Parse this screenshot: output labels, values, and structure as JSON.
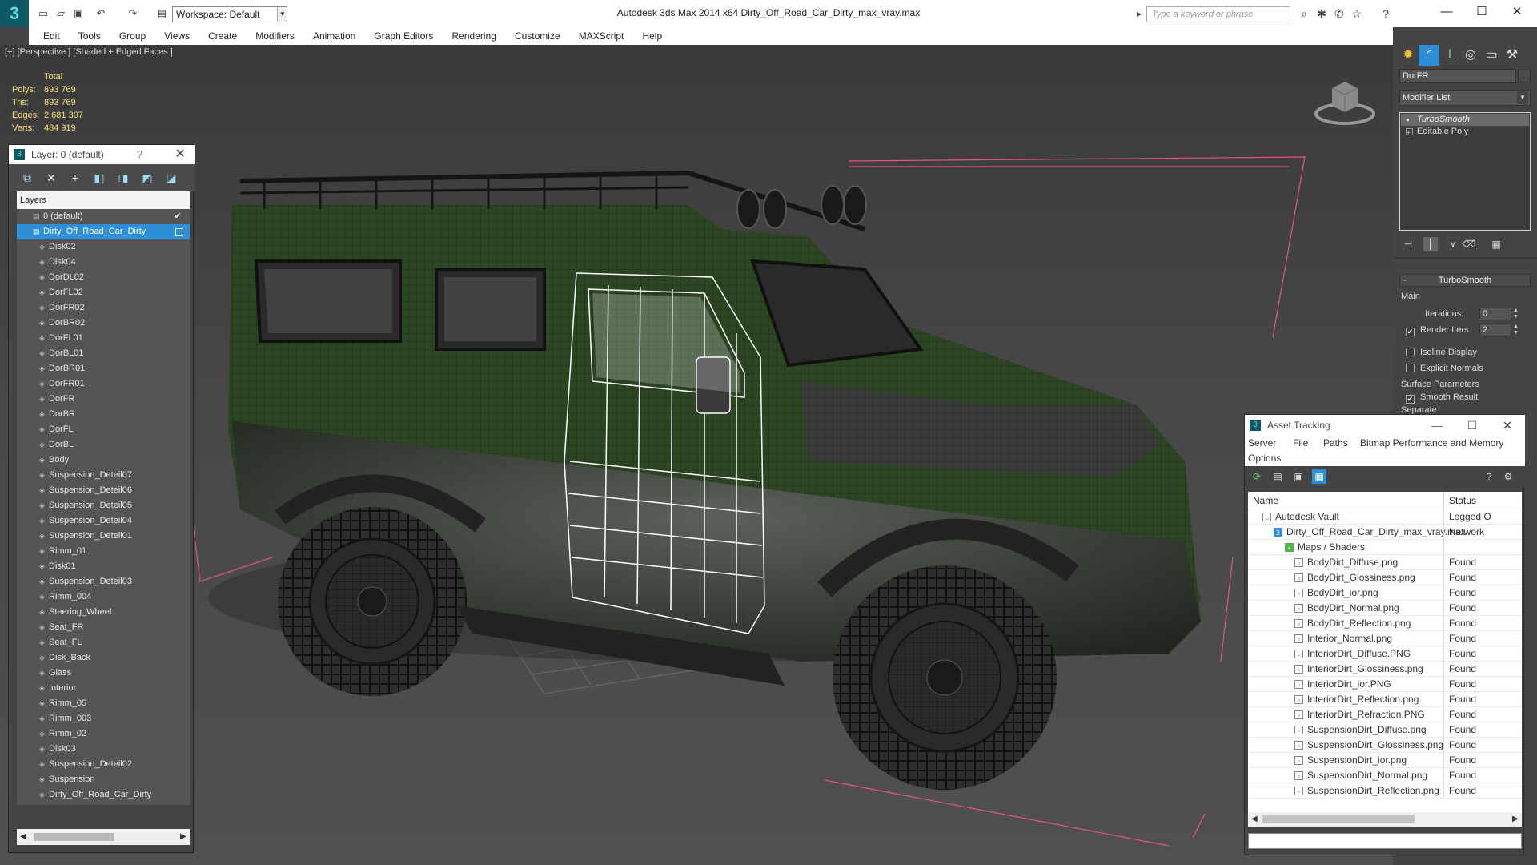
{
  "app": {
    "title": "Autodesk 3ds Max  2014 x64      Dirty_Off_Road_Car_Dirty_max_vray.max",
    "workspace": "Workspace: Default",
    "search_placeholder": "Type a keyword or phrase",
    "logo_glyph": "3"
  },
  "menu": [
    "Edit",
    "Tools",
    "Group",
    "Views",
    "Create",
    "Modifiers",
    "Animation",
    "Graph Editors",
    "Rendering",
    "Customize",
    "MAXScript",
    "Help"
  ],
  "viewport": {
    "label": "[+] [Perspective ] [Shaded + Edged Faces ]",
    "stats": {
      "header": "Total",
      "rows": [
        {
          "label": "Polys:",
          "value": "893 769"
        },
        {
          "label": "Tris:",
          "value": "893 769"
        },
        {
          "label": "Edges:",
          "value": "2 681 307"
        },
        {
          "label": "Verts:",
          "value": "484 919"
        }
      ]
    },
    "colors": {
      "stats": "#ffe27a",
      "bounding_box": "#e8547e",
      "selection_wire": "#ffffff",
      "car_body": "#2f4a24"
    }
  },
  "layer_panel": {
    "title": "Layer: 0 (default)",
    "help": "?",
    "column_header": "Layers",
    "top_layers": [
      {
        "name": "0 (default)"
      },
      {
        "name": "Dirty_Off_Road_Car_Dirty",
        "selected": true
      }
    ],
    "objects": [
      "Disk02",
      "Disk04",
      "DorDL02",
      "DorFL02",
      "DorFR02",
      "DorBR02",
      "DorFL01",
      "DorBL01",
      "DorBR01",
      "DorFR01",
      "DorFR",
      "DorBR",
      "DorFL",
      "DorBL",
      "Body",
      "Suspension_Deteil07",
      "Suspension_Deteil06",
      "Suspension_Deteil05",
      "Suspension_Deteil04",
      "Suspension_Deteil01",
      "Rimm_01",
      "Disk01",
      "Suspension_Deteil03",
      "Rimm_004",
      "Steering_Wheel",
      "Seat_FR",
      "Seat_FL",
      "Disk_Back",
      "Glass",
      "Interior",
      "Rimm_05",
      "Rimm_003",
      "Rimm_02",
      "Disk03",
      "Suspension_Deteil02",
      "Suspension",
      "Dirty_Off_Road_Car_Dirty"
    ]
  },
  "command_panel": {
    "object_name": "DorFR",
    "modifier_list": "Modifier List",
    "stack": [
      "TurboSmooth",
      "Editable Poly"
    ],
    "rollout_title": "TurboSmooth",
    "main_group": "Main",
    "iterations_label": "Iterations:",
    "iterations_value": "0",
    "render_iters_label": "Render Iters:",
    "render_iters_value": "2",
    "render_iters_checked": true,
    "isoline_label": "Isoline Display",
    "explicit_label": "Explicit Normals",
    "surface_group": "Surface Parameters",
    "smooth_result_label": "Smooth Result",
    "separate_label": "Separate"
  },
  "asset_tracking": {
    "title": "Asset Tracking",
    "menu": [
      "Server",
      "File",
      "Paths",
      "Bitmap Performance and Memory",
      "Options"
    ],
    "col_name": "Name",
    "col_status": "Status",
    "rows": [
      {
        "name": "Autodesk Vault",
        "status": "Logged O",
        "level": 1
      },
      {
        "name": "Dirty_Off_Road_Car_Dirty_max_vray.max",
        "status": "Network",
        "level": 2
      },
      {
        "name": "Maps / Shaders",
        "status": "",
        "level": 3
      },
      {
        "name": "BodyDirt_Diffuse.png",
        "status": "Found",
        "level": 4
      },
      {
        "name": "BodyDirt_Glossiness.png",
        "status": "Found",
        "level": 4
      },
      {
        "name": "BodyDirt_ior.png",
        "status": "Found",
        "level": 4
      },
      {
        "name": "BodyDirt_Normal.png",
        "status": "Found",
        "level": 4
      },
      {
        "name": "BodyDirt_Reflection.png",
        "status": "Found",
        "level": 4
      },
      {
        "name": "Interior_Normal.png",
        "status": "Found",
        "level": 4
      },
      {
        "name": "InteriorDirt_Diffuse.PNG",
        "status": "Found",
        "level": 4
      },
      {
        "name": "InteriorDirt_Glossiness.png",
        "status": "Found",
        "level": 4
      },
      {
        "name": "InteriorDirt_ior.PNG",
        "status": "Found",
        "level": 4
      },
      {
        "name": "InteriorDirt_Reflection.png",
        "status": "Found",
        "level": 4
      },
      {
        "name": "InteriorDirt_Refraction.PNG",
        "status": "Found",
        "level": 4
      },
      {
        "name": "SuspensionDirt_Diffuse.png",
        "status": "Found",
        "level": 4
      },
      {
        "name": "SuspensionDirt_Glossiness.png",
        "status": "Found",
        "level": 4
      },
      {
        "name": "SuspensionDirt_ior.png",
        "status": "Found",
        "level": 4
      },
      {
        "name": "SuspensionDirt_Normal.png",
        "status": "Found",
        "level": 4
      },
      {
        "name": "SuspensionDirt_Reflection.png",
        "status": "Found",
        "level": 4
      }
    ]
  }
}
